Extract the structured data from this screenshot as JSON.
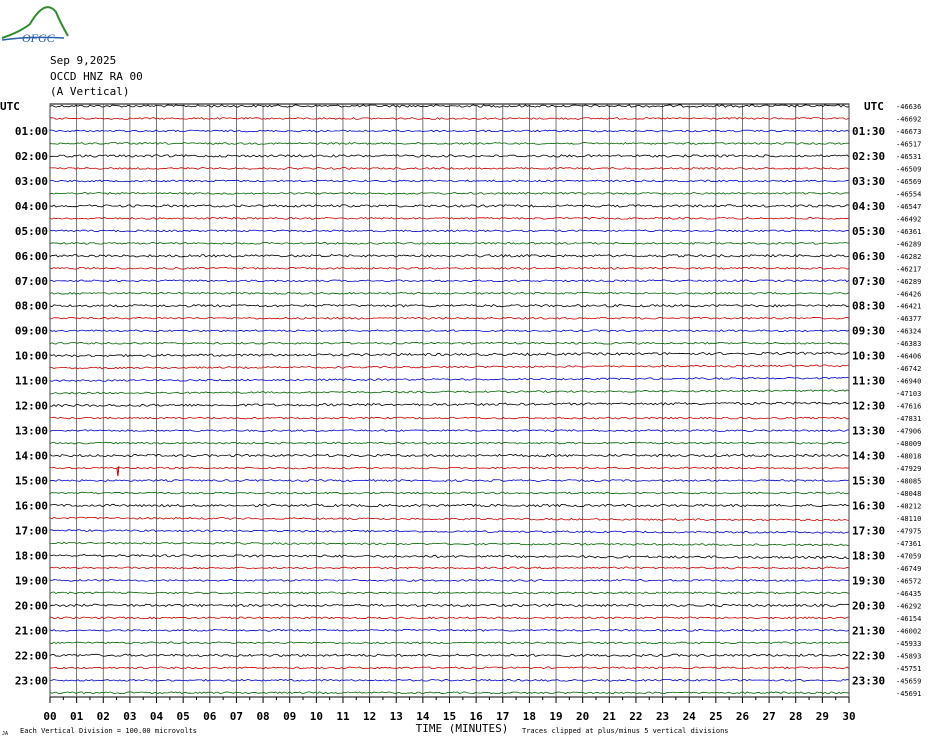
{
  "header": {
    "date": "Sep 9,2025",
    "station": "OCCD HNZ RA 00",
    "component": "(A Vertical)",
    "logo_text": "OFGC"
  },
  "colors": {
    "trace_cycle": [
      "#000000",
      "#cc0000",
      "#0000cc",
      "#006600"
    ],
    "grid": "#000000",
    "background": "#ffffff"
  },
  "chart_data": {
    "type": "line",
    "title": "",
    "xlabel": "TIME (MINUTES)",
    "ylabel": "",
    "left_axis_label": "UTC",
    "right_axis_label": "UTC",
    "xlim": [
      0,
      30
    ],
    "x_ticks": [
      "00",
      "01",
      "02",
      "03",
      "04",
      "05",
      "06",
      "07",
      "08",
      "09",
      "10",
      "11",
      "12",
      "13",
      "14",
      "15",
      "16",
      "17",
      "18",
      "19",
      "20",
      "21",
      "22",
      "23",
      "24",
      "25",
      "26",
      "27",
      "28",
      "29",
      "30"
    ],
    "left_hour_labels": [
      "01:00",
      "02:00",
      "03:00",
      "04:00",
      "05:00",
      "06:00",
      "07:00",
      "08:00",
      "09:00",
      "10:00",
      "11:00",
      "12:00",
      "13:00",
      "14:00",
      "15:00",
      "16:00",
      "17:00",
      "18:00",
      "19:00",
      "20:00",
      "21:00",
      "22:00",
      "23:00"
    ],
    "right_hour_labels": [
      "01:30",
      "02:30",
      "03:30",
      "04:30",
      "05:30",
      "06:30",
      "07:30",
      "08:30",
      "09:30",
      "10:30",
      "11:30",
      "12:30",
      "13:30",
      "14:30",
      "15:30",
      "16:30",
      "17:30",
      "18:30",
      "19:30",
      "20:30",
      "21:30",
      "22:30",
      "23:30"
    ],
    "trace_offsets": [
      -46636,
      -46692,
      -46673,
      -46517,
      -46531,
      -46509,
      -46569,
      -46554,
      -46547,
      -46492,
      -46361,
      -46289,
      -46282,
      -46217,
      -46289,
      -46426,
      -46421,
      -46377,
      -46324,
      -46383,
      -46406,
      -46742,
      -46940,
      -47103,
      -47616,
      -47831,
      -47906,
      -48009,
      -48018,
      -47929,
      -48085,
      -48048,
      -48212,
      -48110,
      -47975,
      -47361,
      -47059,
      -46749,
      -46572,
      -46435,
      -46292,
      -46154,
      -46002,
      -45933,
      -45893,
      -45751,
      -45659,
      -45691
    ],
    "trace_count": 48,
    "minutes_per_trace": 30,
    "footnote_left": "Each Vertical Division = 100.00 microvolts",
    "footnote_right": "Traces clipped at plus/minus 5 vertical divisions",
    "corner_mark": "JA"
  }
}
